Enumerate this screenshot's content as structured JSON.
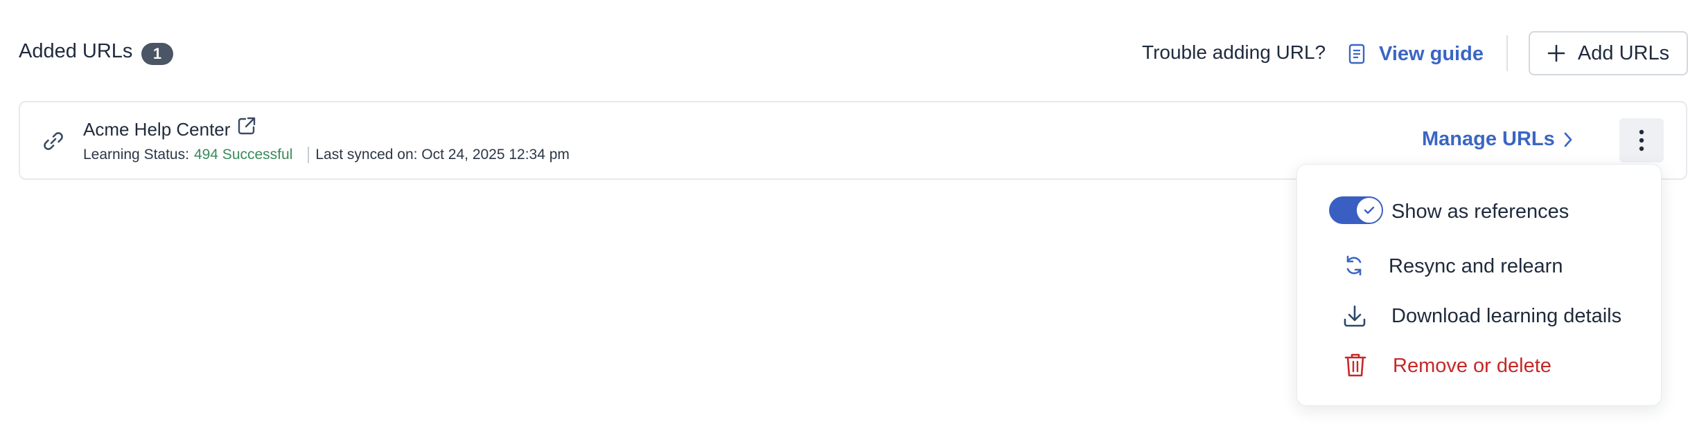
{
  "header": {
    "title": "Added URLs",
    "count": "1",
    "trouble_text": "Trouble adding URL?",
    "view_guide_label": "View guide",
    "add_urls_label": "Add URLs"
  },
  "url_item": {
    "name": "Acme Help Center",
    "status_prefix": "Learning Status:",
    "status_value": "494 Successful",
    "last_synced": "Last synced on: Oct 24, 2025 12:34 pm",
    "manage_label": "Manage URLs"
  },
  "menu": {
    "show_references": {
      "label": "Show as references",
      "enabled": true
    },
    "resync_label": "Resync and relearn",
    "download_label": "Download learning details",
    "remove_label": "Remove or delete"
  },
  "colors": {
    "accent": "#3a66c4",
    "toggle_on": "#3a5fc2",
    "success": "#3a8a5a",
    "danger": "#c62828",
    "badge": "#4a5565"
  },
  "icons": {
    "guide": "document-icon",
    "add": "plus-icon",
    "link": "link-icon",
    "external": "external-link-icon",
    "manage": "chevron-right-icon",
    "more": "kebab-menu-icon",
    "resync": "refresh-icon",
    "download": "download-icon",
    "remove": "trash-icon"
  }
}
